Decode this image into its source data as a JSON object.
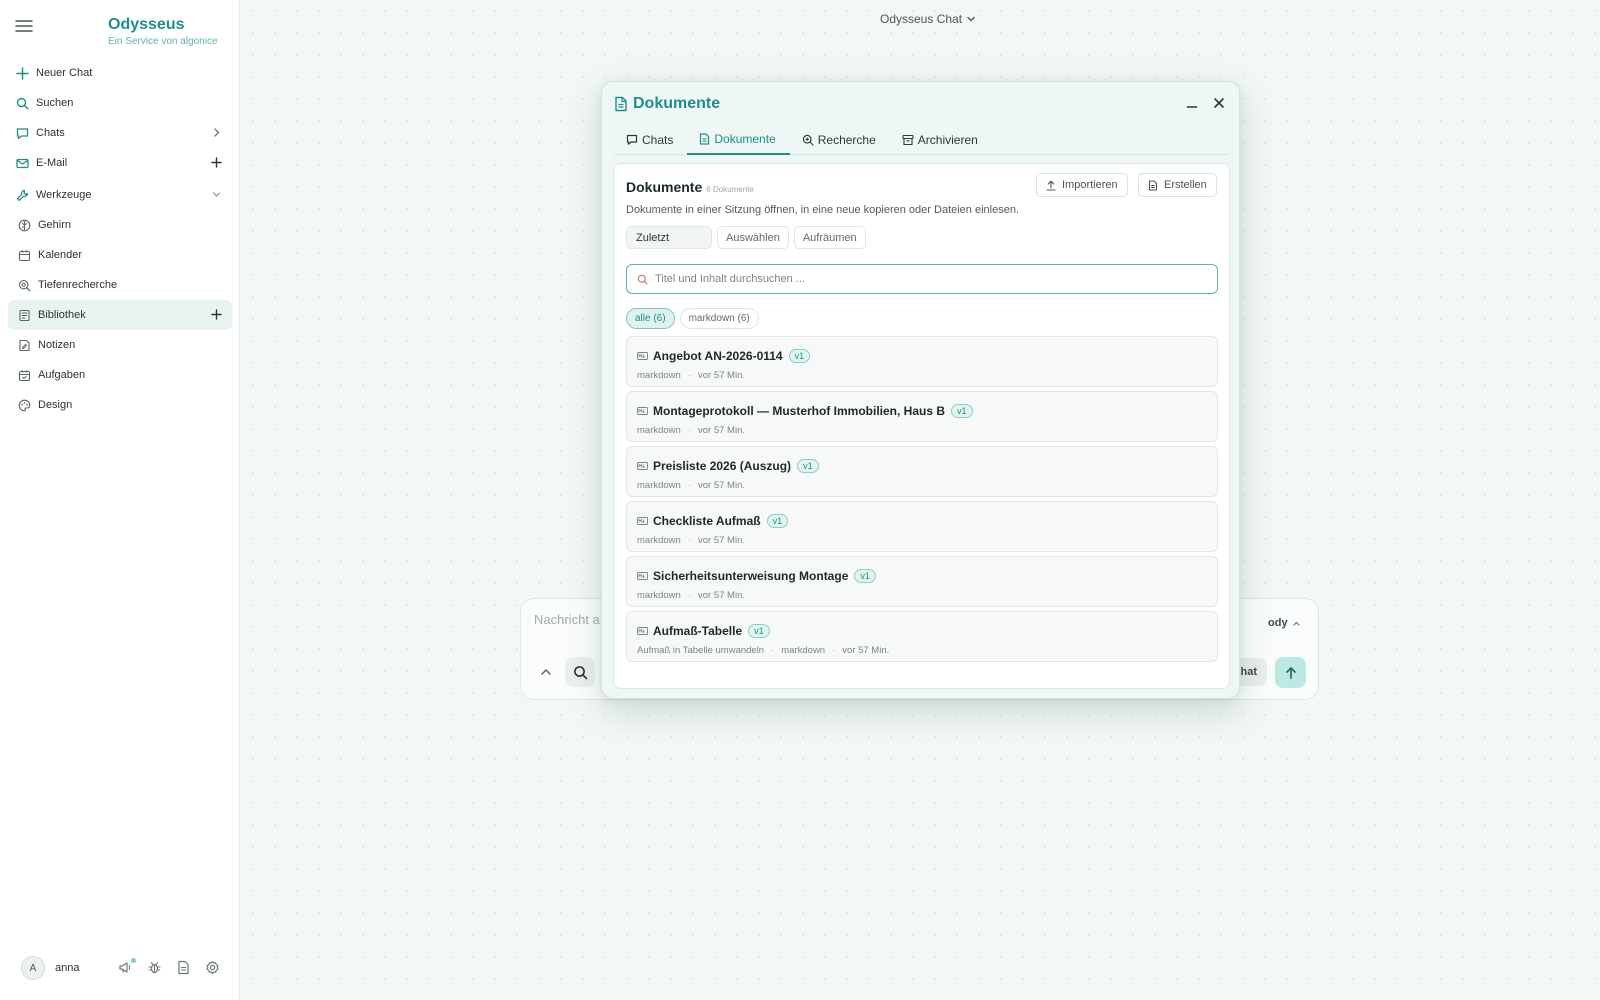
{
  "app": {
    "name": "Odysseus",
    "subtitle": "Ein Service von algonice",
    "top_title": "Odysseus Chat"
  },
  "sidebar": {
    "items": [
      {
        "label": "Neuer Chat",
        "icon": "plus-icon"
      },
      {
        "label": "Suchen",
        "icon": "search-icon"
      },
      {
        "label": "Chats",
        "icon": "chat-bubble-icon",
        "trailing": "chevron-right-icon"
      },
      {
        "label": "E-Mail",
        "icon": "mail-icon",
        "trailing": "plus-icon"
      },
      {
        "label": "Werkzeuge",
        "icon": "wrench-icon",
        "trailing": "chevron-down-icon"
      },
      {
        "label": "Gehirn",
        "icon": "brain-icon"
      },
      {
        "label": "Kalender",
        "icon": "calendar-icon"
      },
      {
        "label": "Tiefenrecherche",
        "icon": "deep-search-icon"
      },
      {
        "label": "Bibliothek",
        "icon": "library-icon",
        "trailing": "plus-icon",
        "active": true
      },
      {
        "label": "Notizen",
        "icon": "note-icon"
      },
      {
        "label": "Aufgaben",
        "icon": "tasks-icon"
      },
      {
        "label": "Design",
        "icon": "palette-icon"
      }
    ],
    "user": {
      "initial": "A",
      "name": "anna"
    }
  },
  "composer": {
    "placeholder": "Nachricht a",
    "model_label": "ody",
    "chat_label": "hat"
  },
  "modal": {
    "title": "Dokumente",
    "tabs": [
      {
        "label": "Chats",
        "icon": "chat-bubble-icon"
      },
      {
        "label": "Dokumente",
        "icon": "document-icon",
        "active": true
      },
      {
        "label": "Recherche",
        "icon": "search-zoom-icon"
      },
      {
        "label": "Archivieren",
        "icon": "archive-icon"
      }
    ],
    "panel": {
      "title": "Dokumente",
      "count": "6 Dokumente",
      "description": "Dokumente in einer Sitzung öffnen, in eine neue kopieren oder Dateien einlesen.",
      "import_label": "Importieren",
      "create_label": "Erstellen",
      "sort_value": "Zuletzt",
      "select_label": "Auswählen",
      "cleanup_label": "Aufräumen",
      "search_placeholder": "Titel und Inhalt durchsuchen ...",
      "chips": [
        {
          "label": "alle (6)",
          "active": true
        },
        {
          "label": "markdown (6)",
          "active": false
        }
      ],
      "documents": [
        {
          "name": "Angebot AN-2026-0114",
          "version": "v1",
          "meta": [
            "markdown",
            "vor 57 Min."
          ]
        },
        {
          "name": "Montageprotokoll — Musterhof Immobilien, Haus B",
          "version": "v1",
          "meta": [
            "markdown",
            "vor 57 Min."
          ]
        },
        {
          "name": "Preisliste 2026 (Auszug)",
          "version": "v1",
          "meta": [
            "markdown",
            "vor 57 Min."
          ]
        },
        {
          "name": "Checkliste Aufmaß",
          "version": "v1",
          "meta": [
            "markdown",
            "vor 57 Min."
          ]
        },
        {
          "name": "Sicherheitsunterweisung Montage",
          "version": "v1",
          "meta": [
            "markdown",
            "vor 57 Min."
          ]
        },
        {
          "name": "Aufmaß-Tabelle",
          "version": "v1",
          "meta": [
            "Aufmaß in Tabelle umwandeln",
            "markdown",
            "vor 57 Min."
          ]
        }
      ]
    }
  },
  "colors": {
    "accent": "#1f8f86",
    "accent_light": "#dff2ee",
    "background": "#f2f8f7"
  }
}
